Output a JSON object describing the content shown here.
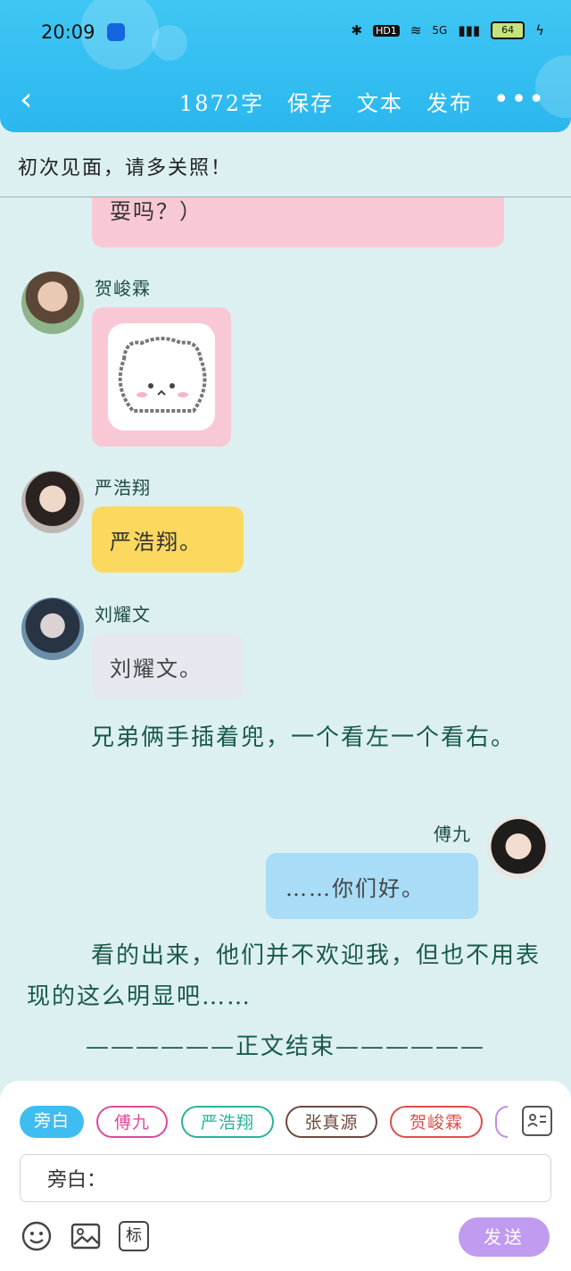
{
  "status_bar": {
    "time": "20:09",
    "hd_label": "HD1",
    "network": "5G",
    "battery": "64"
  },
  "header": {
    "back_icon": "chevron-left-icon",
    "word_count": "1872字",
    "save": "保存",
    "text": "文本",
    "publish": "发布",
    "more_icon": "more-dots-icon"
  },
  "story": {
    "title": "初次见面，请多关照！"
  },
  "messages": [
    {
      "speaker": "",
      "text": "耍吗？）",
      "color": "#f8c9d4"
    },
    {
      "speaker": "贺峻霖",
      "type": "sticker",
      "color": "#f8c9d4"
    },
    {
      "speaker": "严浩翔",
      "text": "严浩翔。",
      "color": "#fbd95f"
    },
    {
      "speaker": "刘耀文",
      "text": "刘耀文。",
      "color": "#e6e8ef"
    },
    {
      "narration": "兄弟俩手插着兜，一个看左一个看右。"
    },
    {
      "speaker": "傅九",
      "text": "……你们好。",
      "color": "#a9dcf6",
      "self": true
    },
    {
      "narration": "看的出来，他们并不欢迎我，但也不用表现的这么明显吧……"
    },
    {
      "narration": "——————正文结束——————"
    }
  ],
  "composer": {
    "roles": [
      {
        "label": "旁白",
        "color": "#3fbdf0",
        "active": true
      },
      {
        "label": "傅九",
        "color": "#e0489b"
      },
      {
        "label": "严浩翔",
        "color": "#29b29a"
      },
      {
        "label": "张真源",
        "color": "#6b4a3e"
      },
      {
        "label": "贺峻霖",
        "color": "#e04c4c"
      }
    ],
    "input_value": "旁白：",
    "mark_label": "标",
    "send_label": "发送",
    "accent": "#c09bf0"
  }
}
